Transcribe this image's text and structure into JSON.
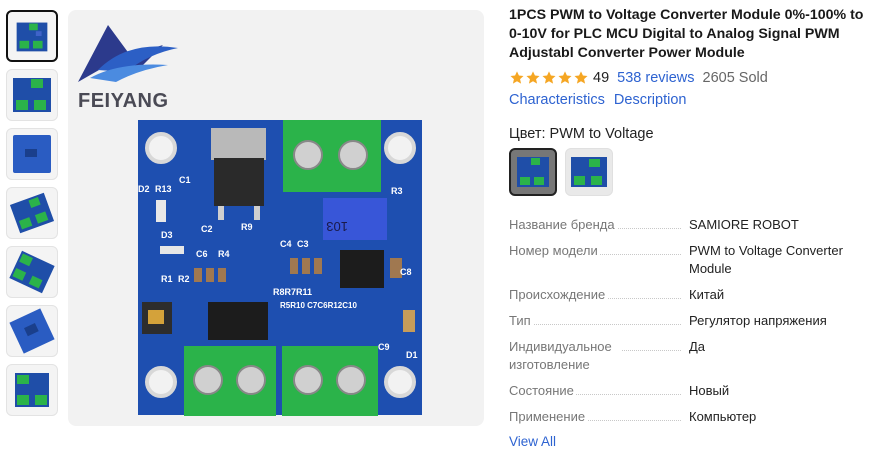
{
  "thumbnails": [
    {
      "name": "thumb-1"
    },
    {
      "name": "thumb-2"
    },
    {
      "name": "thumb-3"
    },
    {
      "name": "thumb-4"
    },
    {
      "name": "thumb-5"
    },
    {
      "name": "thumb-6"
    },
    {
      "name": "thumb-7"
    }
  ],
  "main_image": {
    "logo_text": "FEIYANG",
    "labels": {
      "d2": "D2",
      "r13": "R13",
      "c1": "C1",
      "r3": "R3",
      "d3": "D3",
      "c2": "C2",
      "r9": "R9",
      "c4": "C4",
      "c3": "C3",
      "pot": "103",
      "c6": "C6",
      "r4": "R4",
      "r1": "R1",
      "r2": "R2",
      "r5": "R5",
      "c8": "C8",
      "r8r7r11": "R8R7R11",
      "r5r10": "R5R10 C7C6R12C10",
      "c9": "C9",
      "d1": "D1"
    }
  },
  "product": {
    "title": "1PCS PWM to Voltage Converter Module 0%-100% to 0-10V for PLC MCU Digital to Analog Signal PWM Adjustabl Converter Power Module",
    "rating": "4.9",
    "rating_display": "49",
    "reviews": "538 reviews",
    "sold": "2605 Sold",
    "star_color": "#f5a623",
    "link_color": "#2e63d1",
    "links": {
      "characteristics": "Characteristics",
      "description": "Description"
    },
    "color_label": "Цвет: PWM to Voltage",
    "swatches": [
      {
        "name": "swatch-1"
      },
      {
        "name": "swatch-2"
      }
    ]
  },
  "specs": [
    {
      "key": "Название бренда",
      "value": "SAMIORE ROBOT"
    },
    {
      "key": "Номер модели",
      "value": "PWM to Voltage Converter Module"
    },
    {
      "key": "Происхождение",
      "value": "Китай"
    },
    {
      "key": "Тип",
      "value": "Регулятор напряжения"
    },
    {
      "key": "Индивидуальное изготовление",
      "value": "Да"
    },
    {
      "key": "Состояние",
      "value": "Новый"
    },
    {
      "key": "Применение",
      "value": "Компьютер"
    }
  ],
  "view_all": "View All"
}
